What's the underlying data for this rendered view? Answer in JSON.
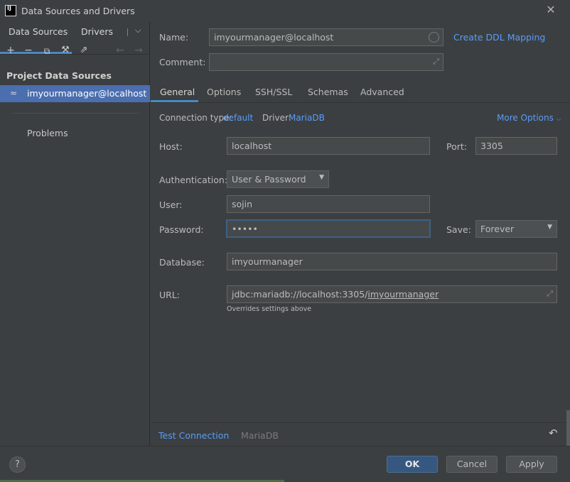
{
  "window": {
    "title": "Data Sources and Drivers",
    "logo": "IJ"
  },
  "left": {
    "tabs": [
      "Data Sources",
      "Drivers"
    ],
    "section_title": "Project Data Sources",
    "data_source": "imyourmanager@localhost",
    "problems": "Problems"
  },
  "form": {
    "name_label": "Name:",
    "name_value": "imyourmanager@localhost",
    "create_ddl": "Create DDL Mapping",
    "comment_label": "Comment:",
    "comment_value": "",
    "tabs": [
      "General",
      "Options",
      "SSH/SSL",
      "Schemas",
      "Advanced"
    ],
    "conn_type_label": "Connection type:",
    "conn_type_value": "default",
    "driver_label": "Driver:",
    "driver_value": "MariaDB",
    "more_options": "More Options",
    "host_label": "Host:",
    "host_value": "localhost",
    "port_label": "Port:",
    "port_value": "3305",
    "auth_label": "Authentication:",
    "auth_value": "User & Password",
    "user_label": "User:",
    "user_value": "sojin",
    "password_label": "Password:",
    "password_value": "•••••",
    "save_label": "Save:",
    "save_value": "Forever",
    "database_label": "Database:",
    "database_value": "imyourmanager",
    "url_label": "URL:",
    "url_prefix": "jdbc:mariadb://localhost:3305/",
    "url_db": "imyourmanager",
    "url_hint": "Overrides settings above",
    "test_connection": "Test Connection",
    "driver_footer": "MariaDB"
  },
  "footer": {
    "help": "?",
    "ok": "OK",
    "cancel": "Cancel",
    "apply": "Apply"
  }
}
